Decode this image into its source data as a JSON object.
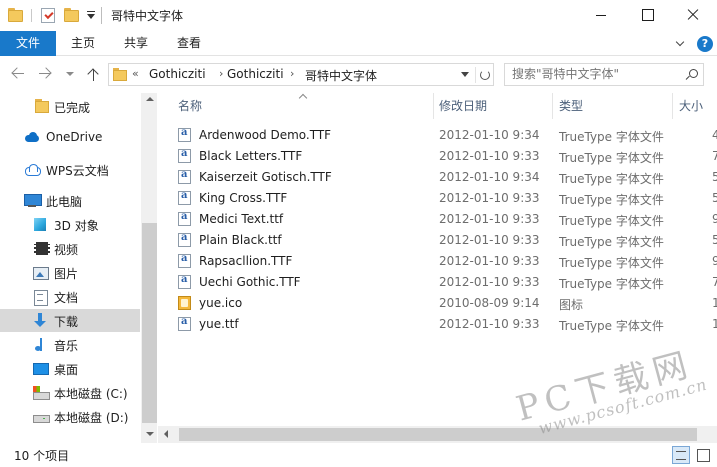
{
  "window": {
    "title": "哥特中文字体"
  },
  "ribbon": {
    "tabs": [
      "文件",
      "主页",
      "共享",
      "查看"
    ]
  },
  "address": {
    "overflow": "«",
    "crumbs": [
      "Gothicziti",
      "Gothicziti",
      "哥特中文字体"
    ],
    "separator": "›"
  },
  "search": {
    "placeholder": "搜索\"哥特中文字体\""
  },
  "nav": {
    "items": [
      {
        "label": "已完成",
        "icon": "folder-icon"
      },
      {
        "label": "OneDrive",
        "icon": "onedrive-cloud-icon"
      },
      {
        "label": "WPS云文档",
        "icon": "wps-cloud-icon"
      },
      {
        "label": "此电脑",
        "icon": "this-pc-icon"
      },
      {
        "label": "3D 对象",
        "icon": "3d-objects-icon"
      },
      {
        "label": "视频",
        "icon": "video-icon"
      },
      {
        "label": "图片",
        "icon": "pictures-icon"
      },
      {
        "label": "文档",
        "icon": "documents-icon"
      },
      {
        "label": "下载",
        "icon": "downloads-icon"
      },
      {
        "label": "音乐",
        "icon": "music-icon"
      },
      {
        "label": "桌面",
        "icon": "desktop-icon"
      },
      {
        "label": "本地磁盘 (C:)",
        "icon": "drive-c-icon"
      },
      {
        "label": "本地磁盘 (D:)",
        "icon": "drive-d-icon"
      }
    ],
    "selected": "下载"
  },
  "columns": {
    "name": "名称",
    "modified": "修改日期",
    "type": "类型",
    "size": "大小"
  },
  "files": [
    {
      "name": "Ardenwood Demo.TTF",
      "modified": "2012-01-10 9:34",
      "type": "TrueType 字体文件",
      "size": "4",
      "kind": "ttf"
    },
    {
      "name": "Black Letters.TTF",
      "modified": "2012-01-10 9:33",
      "type": "TrueType 字体文件",
      "size": "7",
      "kind": "ttf"
    },
    {
      "name": "Kaiserzeit Gotisch.TTF",
      "modified": "2012-01-10 9:34",
      "type": "TrueType 字体文件",
      "size": "5",
      "kind": "ttf"
    },
    {
      "name": "King Cross.TTF",
      "modified": "2012-01-10 9:33",
      "type": "TrueType 字体文件",
      "size": "5",
      "kind": "ttf"
    },
    {
      "name": "Medici Text.ttf",
      "modified": "2012-01-10 9:33",
      "type": "TrueType 字体文件",
      "size": "9",
      "kind": "ttf"
    },
    {
      "name": "Plain Black.ttf",
      "modified": "2012-01-10 9:33",
      "type": "TrueType 字体文件",
      "size": "5",
      "kind": "ttf"
    },
    {
      "name": "Rapsacllion.TTF",
      "modified": "2012-01-10 9:33",
      "type": "TrueType 字体文件",
      "size": "9",
      "kind": "ttf"
    },
    {
      "name": "Uechi Gothic.TTF",
      "modified": "2012-01-10 9:33",
      "type": "TrueType 字体文件",
      "size": "7",
      "kind": "ttf"
    },
    {
      "name": "yue.ico",
      "modified": "2010-08-09 9:14",
      "type": "图标",
      "size": "1",
      "kind": "ico"
    },
    {
      "name": "yue.ttf",
      "modified": "2012-01-10 9:33",
      "type": "TrueType 字体文件",
      "size": "1",
      "kind": "ttf"
    }
  ],
  "status": {
    "count": "10 个项目"
  },
  "watermark": {
    "main": "PC下载网",
    "sub": "www.pcsoft.com.cn"
  }
}
